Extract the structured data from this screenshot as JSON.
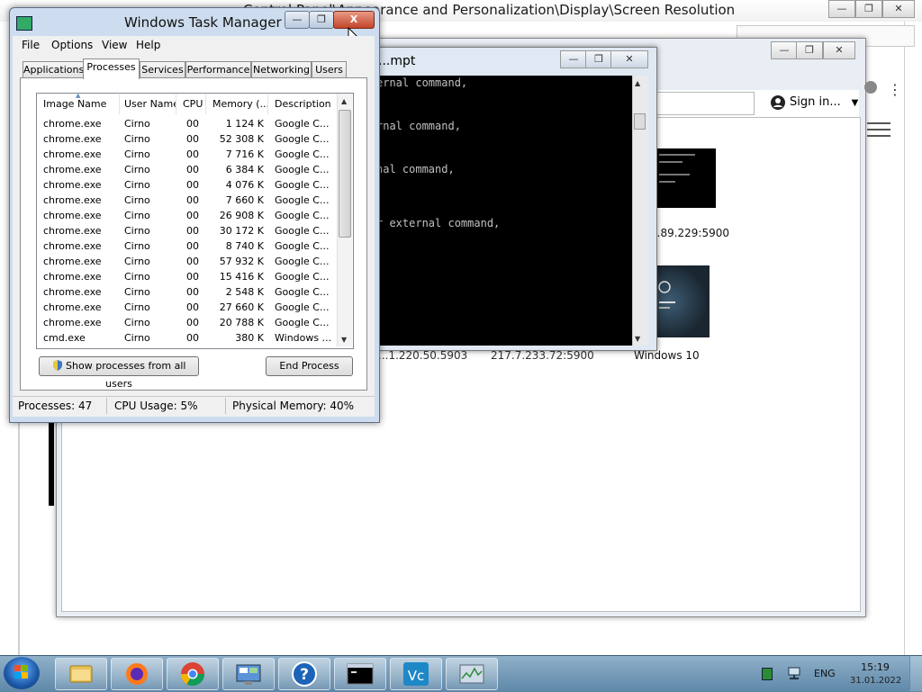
{
  "background_window": {
    "title": "Control Panel\\Appearance and Personalization\\Display\\Screen Resolution",
    "controls": {
      "minimize": "—",
      "restore": "❐",
      "close": "✕"
    }
  },
  "vnc_viewer": {
    "controls": {
      "minimize": "—",
      "restore": "❐",
      "close": "✕"
    },
    "sign_in": "Sign in...",
    "menu_icon": "kebab-menu-icon",
    "connections": [
      {
        "label": "...89.229:5900"
      },
      {
        "label": "Windows 10"
      },
      {
        "label": "...1.220.50.5903"
      },
      {
        "label": "217.7.233.72:5900"
      }
    ]
  },
  "cmd_window": {
    "title": "...mpt",
    "controls": {
      "minimize": "—",
      "restore": "❐",
      "close": "✕"
    },
    "lines": [
      "ernal command,",
      "rnal command,",
      "nal command,",
      "r external command,"
    ]
  },
  "task_manager": {
    "title": "Windows Task Manager",
    "controls": {
      "minimize": "—",
      "restore": "❐",
      "close": "X"
    },
    "menu": [
      "File",
      "Options",
      "View",
      "Help"
    ],
    "tabs": [
      "Applications",
      "Processes",
      "Services",
      "Performance",
      "Networking",
      "Users"
    ],
    "active_tab": "Processes",
    "columns": [
      "Image Name",
      "User Name",
      "CPU",
      "Memory (...",
      "Description"
    ],
    "sort_indicator": "▲",
    "rows": [
      [
        "chrome.exe",
        "Cirno",
        "00",
        "1 124 K",
        "Google C..."
      ],
      [
        "chrome.exe",
        "Cirno",
        "00",
        "52 308 K",
        "Google C..."
      ],
      [
        "chrome.exe",
        "Cirno",
        "00",
        "7 716 K",
        "Google C..."
      ],
      [
        "chrome.exe",
        "Cirno",
        "00",
        "6 384 K",
        "Google C..."
      ],
      [
        "chrome.exe",
        "Cirno",
        "00",
        "4 076 K",
        "Google C..."
      ],
      [
        "chrome.exe",
        "Cirno",
        "00",
        "7 660 K",
        "Google C..."
      ],
      [
        "chrome.exe",
        "Cirno",
        "00",
        "26 908 K",
        "Google C..."
      ],
      [
        "chrome.exe",
        "Cirno",
        "00",
        "30 172 K",
        "Google C..."
      ],
      [
        "chrome.exe",
        "Cirno",
        "00",
        "8 740 K",
        "Google C..."
      ],
      [
        "chrome.exe",
        "Cirno",
        "00",
        "57 932 K",
        "Google C..."
      ],
      [
        "chrome.exe",
        "Cirno",
        "00",
        "15 416 K",
        "Google C..."
      ],
      [
        "chrome.exe",
        "Cirno",
        "00",
        "2 548 K",
        "Google C..."
      ],
      [
        "chrome.exe",
        "Cirno",
        "00",
        "27 660 K",
        "Google C..."
      ],
      [
        "chrome.exe",
        "Cirno",
        "00",
        "20 788 K",
        "Google C..."
      ],
      [
        "cmd.exe",
        "Cirno",
        "00",
        "380 K",
        "Windows ..."
      ]
    ],
    "show_all_button": "Show processes from all users",
    "end_process_button": "End Process",
    "status": {
      "processes": "Processes: 47",
      "cpu": "CPU Usage: 5%",
      "memory": "Physical Memory: 40%"
    }
  },
  "taskbar": {
    "pinned": [
      "explorer-icon",
      "firefox-icon",
      "chrome-icon",
      "control-panel-icon",
      "help-icon",
      "cmd-icon",
      "vnc-icon",
      "task-manager-icon"
    ],
    "language": "ENG",
    "time": "15:19",
    "date": "31.01.2022"
  }
}
